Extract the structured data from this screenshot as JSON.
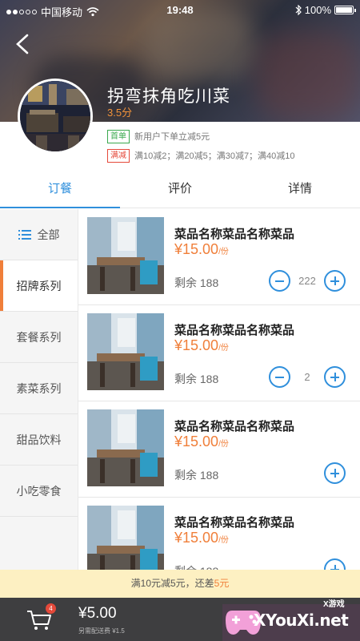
{
  "status_bar": {
    "carrier": "中国移动",
    "time": "19:48",
    "battery": "100%"
  },
  "store": {
    "name": "拐弯抹角吃川菜",
    "score": "3.5分",
    "promotions": [
      {
        "tag": "首单",
        "text": "新用户下单立减5元",
        "color": "#3aa94e"
      },
      {
        "tag": "满减",
        "text": "满10减2；满20减5；满30减7；满40减10",
        "color": "#e5493a"
      }
    ]
  },
  "tabs": [
    "订餐",
    "评价",
    "详情"
  ],
  "active_tab": 0,
  "categories": [
    "全部",
    "招牌系列",
    "套餐系列",
    "素菜系列",
    "甜品饮料",
    "小吃零食"
  ],
  "active_category": 1,
  "items": [
    {
      "name": "菜品名称菜品名称菜品",
      "price": "¥15.00",
      "unit": "/份",
      "stock": "剩余 188",
      "qty": "222"
    },
    {
      "name": "菜品名称菜品名称菜品",
      "price": "¥15.00",
      "unit": "/份",
      "stock": "剩余 188",
      "qty": "2"
    },
    {
      "name": "菜品名称菜品名称菜品",
      "price": "¥15.00",
      "unit": "/份",
      "stock": "剩余 188",
      "qty": ""
    },
    {
      "name": "菜品名称菜品名称菜品",
      "price": "¥15.00",
      "unit": "/份",
      "stock": "剩余 188",
      "qty": ""
    }
  ],
  "discount_bar": {
    "prefix": "满10元减5元，还差",
    "highlight": "5元"
  },
  "cart": {
    "badge": "4",
    "total": "¥5.00",
    "fee": "另需配送费 ¥1.5"
  },
  "watermark": {
    "text": "XYouXi.net",
    "small": "X游戏"
  },
  "colors": {
    "accent": "#2f8fdc",
    "price": "#f07f3a",
    "active_indicator": "#f07f3a"
  }
}
